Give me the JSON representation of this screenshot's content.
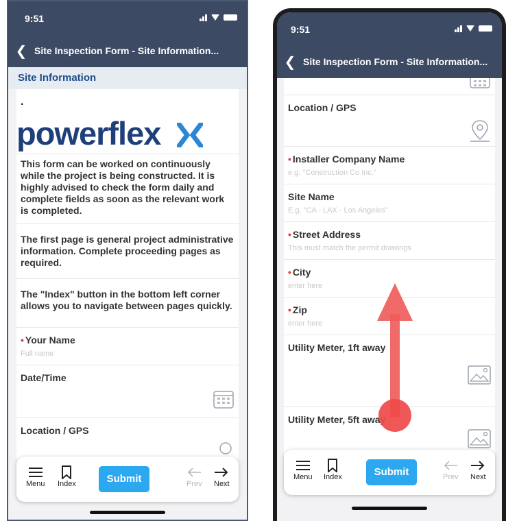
{
  "status": {
    "time": "9:51"
  },
  "navbar": {
    "title": "Site Inspection Form - Site Information..."
  },
  "left": {
    "section_title": "Site Information",
    "dot": ".",
    "logo_text": "powerflex",
    "intro_1": "This form can be worked on continuously while the project is being constructed. It is highly advised to check the form daily and complete fields as soon as the relevant work is completed.",
    "intro_2": "The first page is general project administrative information. Complete proceeding pages as required.",
    "intro_3": "The \"Index\" button in the bottom left corner allows you to navigate between pages quickly.",
    "your_name_label": "Your Name",
    "your_name_placeholder": "Full name",
    "datetime_label": "Date/Time",
    "location_label": "Location / GPS"
  },
  "right": {
    "location_label": "Location / GPS",
    "installer_label": "Installer Company Name",
    "installer_placeholder": "e.g. \"Construction Co Inc.\"",
    "site_name_label": "Site Name",
    "site_name_placeholder": "E.g. \"CA - LAX - Los Angeles\"",
    "street_label": "Street Address",
    "street_placeholder": "This must match the permit drawings",
    "city_label": "City",
    "city_placeholder": "enter here",
    "zip_label": "Zip",
    "zip_placeholder": "enter here",
    "meter1_label": "Utility Meter, 1ft away",
    "meter5_label": "Utility Meter, 5ft away"
  },
  "bottombar": {
    "menu": "Menu",
    "index": "Index",
    "submit": "Submit",
    "prev": "Prev",
    "next": "Next"
  },
  "colors": {
    "header": "#3c4a63",
    "accent": "#2ba8f0",
    "required": "#e23c3c",
    "arrow": "#f05a5a"
  }
}
